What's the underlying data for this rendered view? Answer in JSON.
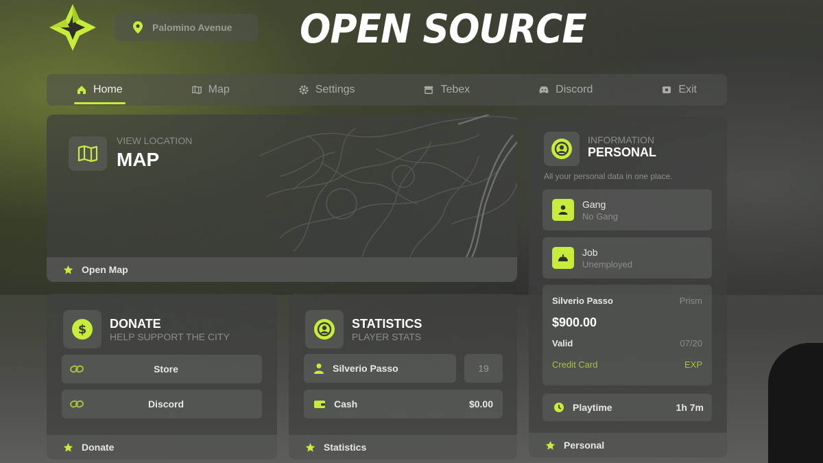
{
  "header": {
    "location": "Palomino Avenue",
    "headline": "OPEN SOURCE"
  },
  "nav": {
    "items": [
      {
        "label": "Home",
        "icon": "home-icon",
        "active": true
      },
      {
        "label": "Map",
        "icon": "map-icon",
        "active": false
      },
      {
        "label": "Settings",
        "icon": "gear-icon",
        "active": false
      },
      {
        "label": "Tebex",
        "icon": "store-icon",
        "active": false
      },
      {
        "label": "Discord",
        "icon": "discord-icon",
        "active": false
      },
      {
        "label": "Exit",
        "icon": "exit-icon",
        "active": false
      }
    ]
  },
  "map_panel": {
    "subtitle": "VIEW LOCATION",
    "title": "MAP",
    "footer": "Open Map"
  },
  "donate_panel": {
    "title": "DONATE",
    "subtitle": "HELP SUPPORT THE CITY",
    "buttons": [
      {
        "label": "Store"
      },
      {
        "label": "Discord"
      }
    ],
    "footer": "Donate"
  },
  "stats_panel": {
    "title": "STATISTICS",
    "subtitle": "PLAYER STATS",
    "player_name": "Silverio Passo",
    "player_id": "19",
    "cash_label": "Cash",
    "cash_value": "$0.00",
    "footer": "Statistics"
  },
  "personal_panel": {
    "subtitle": "INFORMATION",
    "title": "PERSONAL",
    "description": "All your personal data in one place.",
    "gang": {
      "label": "Gang",
      "value": "No Gang"
    },
    "job": {
      "label": "Job",
      "value": "Unemployed"
    },
    "card": {
      "holder": "Silverio Passo",
      "bank": "Prism",
      "amount": "$900.00",
      "valid_label": "Valid",
      "expiry": "07/20",
      "type": "Credit Card",
      "exp_label": "EXP"
    },
    "playtime": {
      "label": "Playtime",
      "value": "1h 7m"
    },
    "footer": "Personal"
  },
  "colors": {
    "accent": "#c7ec3a",
    "panel": "#3e403e",
    "text_muted": "#8c8e8a"
  }
}
